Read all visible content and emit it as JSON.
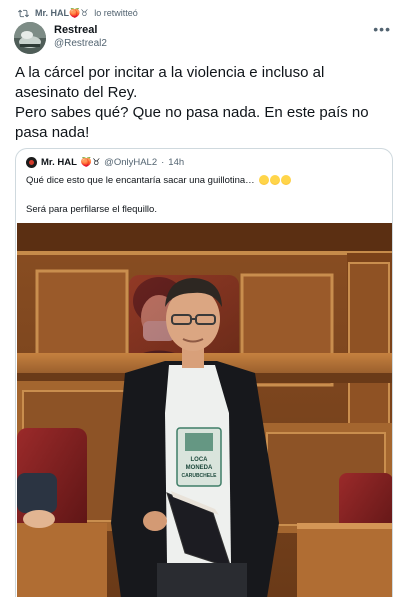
{
  "retweet": {
    "user": "Mr. HAL🍑♉",
    "suffix": "lo retwitteó"
  },
  "author": {
    "name": "Restreal",
    "handle": "@Restreal2"
  },
  "tweet": {
    "lines": [
      "A la cárcel por incitar a la violencia e incluso al",
      "asesinato del Rey.",
      "Pero sabes qué? Que no pasa nada. En este país no",
      "pasa nada!"
    ]
  },
  "quote": {
    "name": "Mr. HAL",
    "name_emoji": "🍑♉",
    "handle": "@OnlyHAL2",
    "separator": "·",
    "time": "14h",
    "text1": "Qué dice esto que le encantaría sacar una guillotina…",
    "text2": "Será para perfilarse el flequillo."
  },
  "photo": {
    "shirt_text": [
      "LOCA",
      "MONEDA",
      "CARUBCHELE"
    ]
  },
  "colors": {
    "text": "#0f1419",
    "secondary": "#536471",
    "border": "#cfd9de",
    "wood": "#b8743a",
    "seat": "#7a1d1d"
  },
  "icons": {
    "retweet": "retweet-icon",
    "more": "more-icon"
  }
}
